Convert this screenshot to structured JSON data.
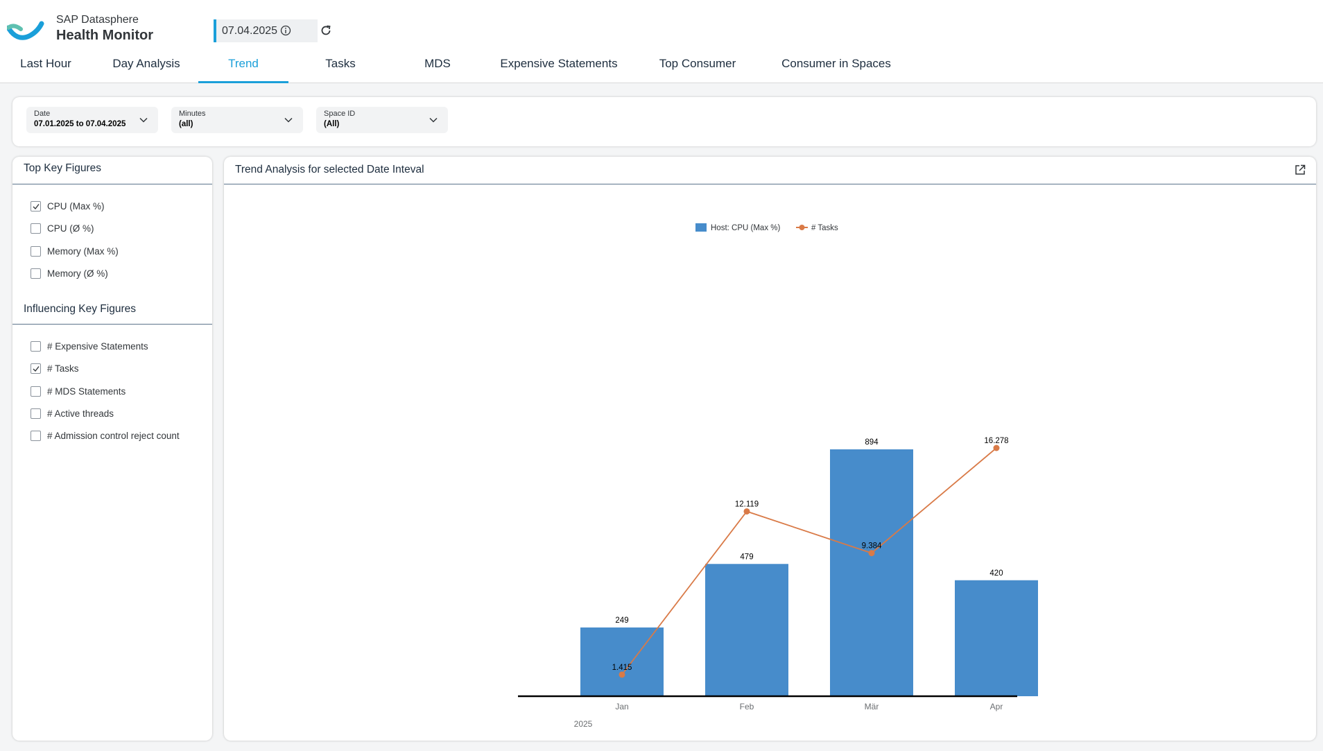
{
  "app": {
    "brand_sub": "SAP Datasphere",
    "brand_title": "Health Monitor",
    "date_value": "07.04.2025"
  },
  "tabs": [
    {
      "label": "Last Hour",
      "active": false
    },
    {
      "label": "Day Analysis",
      "active": false
    },
    {
      "label": "Trend",
      "active": true
    },
    {
      "label": "Tasks",
      "active": false
    },
    {
      "label": "MDS",
      "active": false
    },
    {
      "label": "Expensive Statements",
      "active": false
    },
    {
      "label": "Top Consumer",
      "active": false
    },
    {
      "label": "Consumer in Spaces",
      "active": false
    }
  ],
  "filters": [
    {
      "label": "Date",
      "value": "07.01.2025 to 07.04.2025"
    },
    {
      "label": "Minutes",
      "value": "(all)"
    },
    {
      "label": "Space ID",
      "value": "(All)"
    }
  ],
  "left_panel": {
    "top_title": "Top Key Figures",
    "top_items": [
      {
        "label": "CPU (Max %)",
        "checked": true
      },
      {
        "label": "CPU (Ø %)",
        "checked": false
      },
      {
        "label": "Memory (Max %)",
        "checked": false
      },
      {
        "label": "Memory (Ø %)",
        "checked": false
      }
    ],
    "infl_title": "Influencing Key Figures",
    "infl_items": [
      {
        "label": "# Expensive Statements",
        "checked": false
      },
      {
        "label": "# Tasks",
        "checked": true
      },
      {
        "label": "# MDS Statements",
        "checked": false
      },
      {
        "label": "# Active threads",
        "checked": false
      },
      {
        "label": "# Admission control reject count",
        "checked": false
      }
    ]
  },
  "chart_panel": {
    "title": "Trend Analysis for selected Date Inteval"
  },
  "colors": {
    "accent": "#1a9fd9",
    "bar": "#478ccb",
    "line": "#d97a47"
  },
  "chart_data": {
    "type": "bar",
    "categories": [
      "Jan",
      "Feb",
      "Mär",
      "Apr"
    ],
    "year_label": "2025",
    "series": [
      {
        "name": "Host: CPU (Max %)",
        "type": "bar",
        "values": [
          249,
          479,
          894,
          420
        ],
        "labels": [
          "249",
          "479",
          "894",
          "420"
        ]
      },
      {
        "name": "# Tasks",
        "type": "line",
        "values": [
          1415,
          12119,
          9384,
          16278
        ],
        "labels": [
          "1.415",
          "12.119",
          "9.384",
          "16.278"
        ]
      }
    ],
    "legend_position": "top"
  }
}
